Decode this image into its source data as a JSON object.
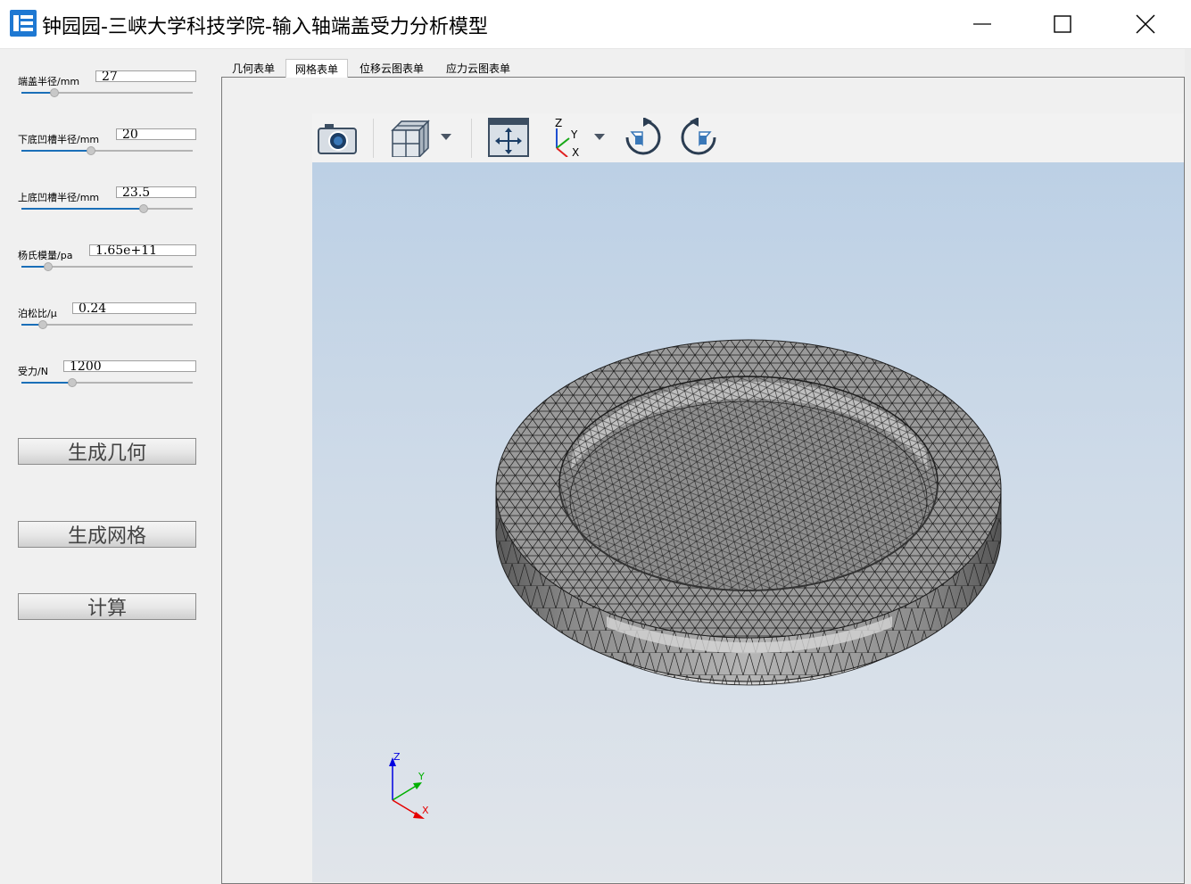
{
  "window": {
    "title": "钟园园-三峡大学科技学院-输入轴端盖受力分析模型",
    "app_icon": "app-logo-icon",
    "controls": [
      "minimize-icon",
      "maximize-icon",
      "close-icon"
    ]
  },
  "params": [
    {
      "label": "端盖半径/mm",
      "value": "27",
      "slider_fraction": 0.19
    },
    {
      "label": "下底凹槽半径/mm",
      "value": "20",
      "slider_fraction": 0.4
    },
    {
      "label": "上底凹槽半径/mm",
      "value": "23.5",
      "slider_fraction": 0.71
    },
    {
      "label": "杨氏模量/pa",
      "value": "1.65e+11",
      "slider_fraction": 0.15
    },
    {
      "label": "泊松比/μ",
      "value": "0.24",
      "slider_fraction": 0.12
    },
    {
      "label": "受力/N",
      "value": "1200",
      "slider_fraction": 0.29
    }
  ],
  "buttons": {
    "generate_geometry": "生成几何",
    "generate_mesh": "生成网格",
    "compute": "计算"
  },
  "tabs": [
    {
      "label": "几何表单",
      "active": false
    },
    {
      "label": "网格表单",
      "active": true
    },
    {
      "label": "位移云图表单",
      "active": false
    },
    {
      "label": "应力云图表单",
      "active": false
    }
  ],
  "toolbar": {
    "icons": [
      "camera-icon",
      "view-cube-icon",
      "dropdown-arrow-icon",
      "fit-view-icon",
      "axis-orientation-icon",
      "dropdown-arrow-icon",
      "rotate-clockwise-icon",
      "rotate-counterclockwise-icon"
    ]
  },
  "axes": {
    "z": "Z",
    "y": "Y",
    "x": "X"
  },
  "colors": {
    "accent": "#1a6fb8",
    "mesh_fill": "#9a9a9a",
    "mesh_lines": "#1e1e1e",
    "background_top": "#bcd0e5",
    "background_bottom": "#e1e5ea",
    "axis_x": "#e60000",
    "axis_y": "#00b000",
    "axis_z": "#0000e0"
  }
}
